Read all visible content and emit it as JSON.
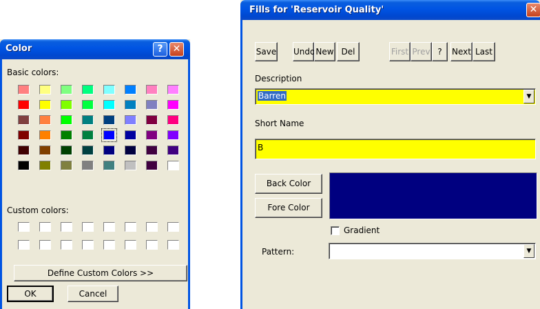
{
  "color_dialog": {
    "title": "Color",
    "basic_colors_label": "Basic colors:",
    "custom_colors_label": "Custom colors:",
    "define_custom_label": "Define Custom Colors >>",
    "ok_label": "OK",
    "cancel_label": "Cancel",
    "selected_swatch": "0000ff",
    "basic_colors": [
      [
        "#ff8080",
        "#ffff80",
        "#80ff80",
        "#00ff80",
        "#80ffff",
        "#0080ff",
        "#ff80c0",
        "#ff80ff"
      ],
      [
        "#ff0000",
        "#ffff00",
        "#80ff00",
        "#00ff40",
        "#00ffff",
        "#0080c0",
        "#8080c0",
        "#ff00ff"
      ],
      [
        "#804040",
        "#ff8040",
        "#00ff00",
        "#008080",
        "#004080",
        "#8080ff",
        "#800040",
        "#ff0080"
      ],
      [
        "#800000",
        "#ff8000",
        "#008000",
        "#008040",
        "#0000ff",
        "#0000a0",
        "#800080",
        "#8000ff"
      ],
      [
        "#400000",
        "#804000",
        "#004000",
        "#004040",
        "#000080",
        "#000040",
        "#400040",
        "#400080"
      ],
      [
        "#000000",
        "#808000",
        "#808040",
        "#808080",
        "#408080",
        "#c0c0c0",
        "#400040",
        "#ffffff"
      ]
    ]
  },
  "fills_dialog": {
    "title": "Fills for 'Reservoir Quality'",
    "toolbar": [
      {
        "label": "Save",
        "enabled": true
      },
      {
        "label": "Undo",
        "enabled": true
      },
      {
        "label": "New",
        "enabled": true
      },
      {
        "label": "Del",
        "enabled": true
      },
      {
        "label": "First",
        "enabled": false
      },
      {
        "label": "Prev",
        "enabled": false
      },
      {
        "label": "?",
        "enabled": true
      },
      {
        "label": "Next",
        "enabled": true
      },
      {
        "label": "Last",
        "enabled": true
      }
    ],
    "description_label": "Description",
    "description_value": "Barren",
    "short_name_label": "Short Name",
    "short_name_value": "B",
    "back_color_label": "Back Color",
    "fore_color_label": "Fore Color",
    "preview_color": "#000080",
    "gradient_label": "Gradient",
    "gradient_checked": false,
    "pattern_label": "Pattern:",
    "pattern_value": ""
  },
  "colors": {
    "field_yellow": "#ffff00",
    "selection_blue": "#316ac5",
    "title_blue": "#0054e3"
  }
}
